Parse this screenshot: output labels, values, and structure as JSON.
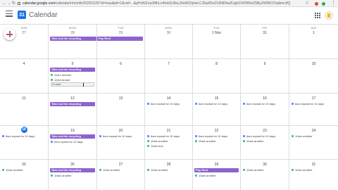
{
  "browser": {
    "url_host": "calendar.google.com",
    "url_path": "/calendar/r/month/2020/1/26?sf=true&pli=1&cid=...&pf=dGFza3MhLmNvbSJ9eyJ0aW1lIjowLCJ0aXRsZSI6IlRha2Ugb3V0IHRoZSByZWN5Y2xpbmcifQ",
    "back_icon": "←",
    "forward_icon": "→",
    "reload_icon": "↻",
    "star_icon": "☆",
    "menu_icon": "⋮"
  },
  "app": {
    "title": "Calendar",
    "logo_text": "31"
  },
  "weekdays": [
    "SUN",
    "MON",
    "TUE",
    "WED",
    "THU",
    "FRI",
    "SAT"
  ],
  "dates": [
    [
      "27",
      "28",
      "29",
      "30",
      "1 Nov",
      "31",
      "1"
    ],
    [
      "4",
      "5",
      "6",
      "7",
      "8",
      "9",
      "10"
    ],
    [
      "11",
      "12",
      "13",
      "14",
      "15",
      "16",
      "17"
    ],
    [
      "18",
      "19",
      "20",
      "21",
      "22",
      "23",
      "24"
    ],
    [
      "25",
      "26",
      "27",
      "28",
      "29",
      "30",
      "31"
    ]
  ],
  "today": {
    "week": 3,
    "day": 0
  },
  "events": {
    "recycling": "Take out the recycling",
    "pay_rent": "Pay Rent",
    "feed_cat": "11am another",
    "tenants": "12pm tenant",
    "editing": "4 more",
    "repeat_10": "6am repeat for 10 days",
    "another": "10am another",
    "text_event": "10am text"
  },
  "colors": {
    "chip": "#8e63ce",
    "today": "#1a73e8",
    "dot_teal": "#33b679",
    "dot_blue": "#4285f4"
  }
}
